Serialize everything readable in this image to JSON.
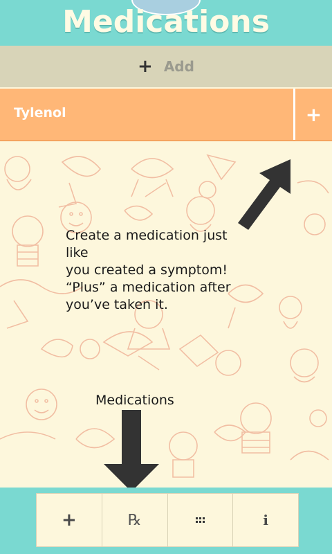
{
  "header": {
    "title": "Medications"
  },
  "add_bar": {
    "icon": "plus-icon",
    "plus_glyph": "+",
    "label": "Add"
  },
  "medications": [
    {
      "name": "Tylenol",
      "action_glyph": "+",
      "action_icon": "plus-icon"
    }
  ],
  "overlay": {
    "instruction_lines": [
      "Create a medication just like",
      "you created a symptom!",
      "“Plus” a medication after",
      "you’ve taken it."
    ],
    "arrow_label": "Medications"
  },
  "tabbar": {
    "tabs": [
      {
        "name": "add",
        "icon": "plus-icon",
        "glyph": "+"
      },
      {
        "name": "medications",
        "icon": "rx-icon",
        "glyph": "℞"
      },
      {
        "name": "grid",
        "icon": "grid-icon",
        "glyph": ""
      },
      {
        "name": "info",
        "icon": "info-icon",
        "glyph": "i"
      }
    ]
  },
  "colors": {
    "header_bg": "#7ad9d1",
    "add_bar_bg": "#d8d4b8",
    "med_row_bg": "#ffb777",
    "body_bg": "#fdf7dc",
    "doodle_stroke": "#f0b59a"
  }
}
